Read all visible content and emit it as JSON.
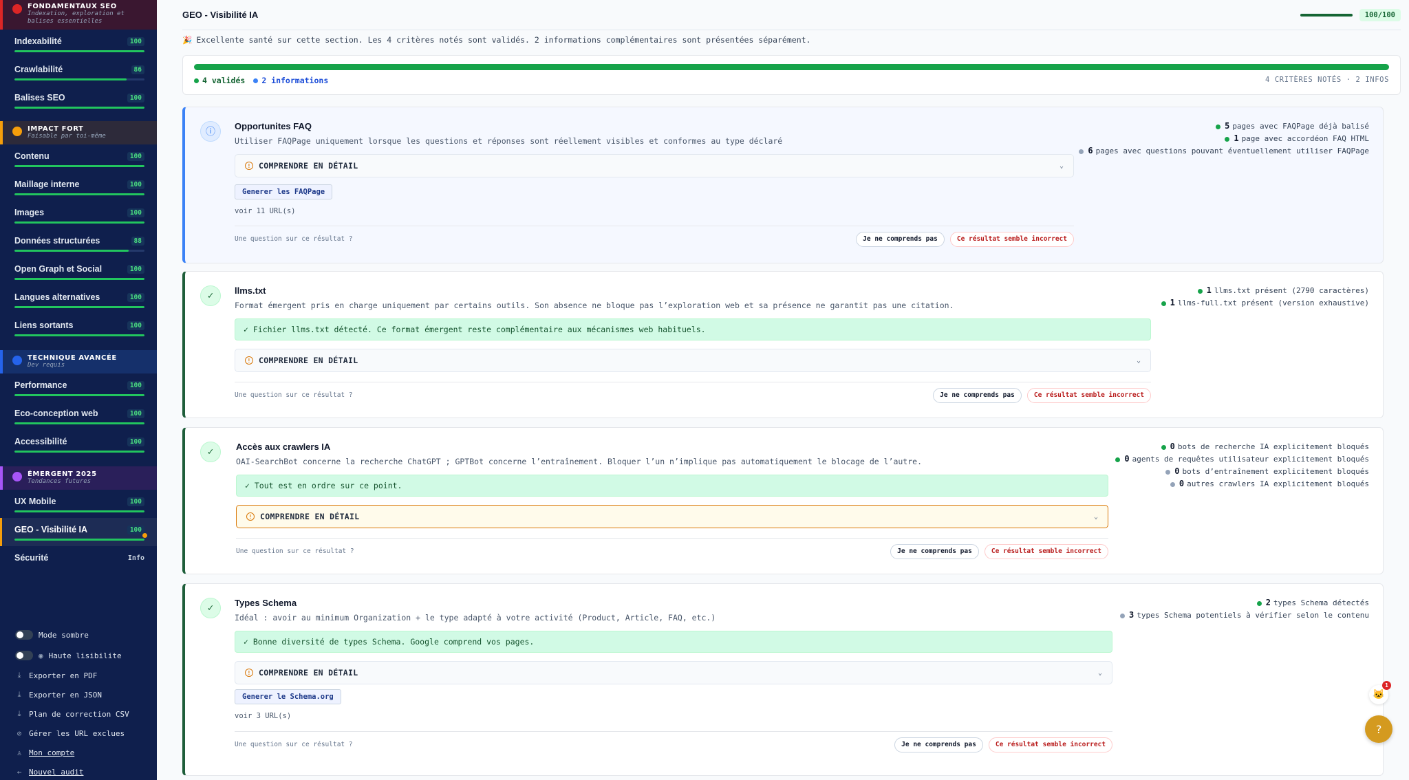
{
  "sidebar": {
    "sections": [
      {
        "title": "FONDAMENTAUX SEO",
        "subtitle": "Indexation, exploration et balises essentielles",
        "color": "#dc2626",
        "items": [
          {
            "label": "Indexabilité",
            "score": "100",
            "fill": 1.0
          },
          {
            "label": "Crawlabilité",
            "score": "86",
            "fill": 0.86
          },
          {
            "label": "Balises SEO",
            "score": "100",
            "fill": 1.0
          }
        ]
      },
      {
        "title": "IMPACT FORT",
        "subtitle": "Faisable par toi-même",
        "color": "#f59e0b",
        "items": [
          {
            "label": "Contenu",
            "score": "100",
            "fill": 1.0
          },
          {
            "label": "Maillage interne",
            "score": "100",
            "fill": 1.0
          },
          {
            "label": "Images",
            "score": "100",
            "fill": 1.0
          },
          {
            "label": "Données structurées",
            "score": "88",
            "fill": 0.88
          },
          {
            "label": "Open Graph et Social",
            "score": "100",
            "fill": 1.0
          },
          {
            "label": "Langues alternatives",
            "score": "100",
            "fill": 1.0
          },
          {
            "label": "Liens sortants",
            "score": "100",
            "fill": 1.0
          }
        ]
      },
      {
        "title": "TECHNIQUE AVANCÉE",
        "subtitle": "Dev requis",
        "color": "#2563eb",
        "items": [
          {
            "label": "Performance",
            "score": "100",
            "fill": 1.0
          },
          {
            "label": "Eco-conception web",
            "score": "100",
            "fill": 1.0
          },
          {
            "label": "Accessibilité",
            "score": "100",
            "fill": 1.0
          }
        ]
      },
      {
        "title": "ÉMERGENT 2025",
        "subtitle": "Tendances futures",
        "color": "#a855f7",
        "items": [
          {
            "label": "UX Mobile",
            "score": "100",
            "fill": 1.0
          },
          {
            "label": "GEO - Visibilité IA",
            "score": "100",
            "fill": 1.0,
            "active": true
          },
          {
            "label": "Sécurité",
            "score": "Info",
            "fill": null
          }
        ]
      }
    ],
    "toggles": [
      {
        "label": "Mode sombre",
        "icon": ""
      },
      {
        "label": "Haute lisibilite",
        "icon": "eye-icon"
      }
    ],
    "links": [
      {
        "label": "Exporter en PDF",
        "icon": "download-icon",
        "underline": false
      },
      {
        "label": "Exporter en JSON",
        "icon": "download-icon",
        "underline": false
      },
      {
        "label": "Plan de correction CSV",
        "icon": "download-icon",
        "underline": false
      },
      {
        "label": "Gérer les URL exclues",
        "icon": "exclude-icon",
        "underline": false
      },
      {
        "label": "Mon compte",
        "icon": "user-icon",
        "underline": true
      },
      {
        "label": "Nouvel audit",
        "icon": "back-arrow-icon",
        "underline": true
      }
    ]
  },
  "header": {
    "title": "GEO - Visibilité IA",
    "score": "100/100",
    "score_fraction": 1.0
  },
  "summary": {
    "emoji": "🎉",
    "text": "Excellente santé sur cette section. Les 4 critères notés sont validés. 2 informations complémentaires sont présentées séparément."
  },
  "overview": {
    "valid": "4 validés",
    "info": "2 informations",
    "right": "4 CRITÈRES NOTÉS · 2 INFOS",
    "fill": 1.0
  },
  "cards": [
    {
      "kind": "info",
      "title": "Opportunites FAQ",
      "desc": "Utiliser FAQPage uniquement lorsque les questions et réponses sont réellement visibles et conformes au type déclaré",
      "okbox": "",
      "detail": "COMPRENDRE EN DÉTAIL",
      "gen": "Generer les FAQPage",
      "voir": "voir 11 URL(s)",
      "question": "Une question sur ce résultat ?",
      "btn_a": "Je ne comprends pas",
      "btn_b": "Ce résultat semble incorrect",
      "stats": [
        {
          "n": "5",
          "t": "pages avec FAQPage déjà balisé",
          "c": "#16a34a"
        },
        {
          "n": "1",
          "t": "page avec accordéon FAQ HTML",
          "c": "#16a34a"
        },
        {
          "n": "6",
          "t": "pages avec questions pouvant éventuellement utiliser FAQPage",
          "c": "#94a3b8"
        }
      ]
    },
    {
      "kind": "ok",
      "title": "llms.txt",
      "desc": "Format émergent pris en charge uniquement par certains outils. Son absence ne bloque pas l’exploration web et sa présence ne garantit pas une citation.",
      "okbox": "✓ Fichier llms.txt détecté. Ce format émergent reste complémentaire aux mécanismes web habituels.",
      "detail": "COMPRENDRE EN DÉTAIL",
      "gen": "",
      "voir": "",
      "question": "Une question sur ce résultat ?",
      "btn_a": "Je ne comprends pas",
      "btn_b": "Ce résultat semble incorrect",
      "stats": [
        {
          "n": "1",
          "t": "llms.txt présent (2790 caractères)",
          "c": "#16a34a"
        },
        {
          "n": "1",
          "t": "llms-full.txt présent (version exhaustive)",
          "c": "#16a34a"
        }
      ]
    },
    {
      "kind": "ok",
      "title": "Accès aux crawlers IA",
      "desc": "OAI-SearchBot concerne la recherche ChatGPT ; GPTBot concerne l’entraînement. Bloquer l’un n’implique pas automatiquement le blocage de l’autre.",
      "okbox": "✓ Tout est en ordre sur ce point.",
      "detail": "COMPRENDRE EN DÉTAIL",
      "gen": "",
      "voir": "",
      "question": "Une question sur ce résultat ?",
      "btn_a": "Je ne comprends pas",
      "btn_b": "Ce résultat semble incorrect",
      "stats": [
        {
          "n": "0",
          "t": "bots de recherche IA explicitement bloqués",
          "c": "#16a34a"
        },
        {
          "n": "0",
          "t": "agents de requêtes utilisateur explicitement bloqués",
          "c": "#16a34a"
        },
        {
          "n": "0",
          "t": "bots d’entraînement explicitement bloqués",
          "c": "#94a3b8"
        },
        {
          "n": "0",
          "t": "autres crawlers IA explicitement bloqués",
          "c": "#94a3b8"
        }
      ]
    },
    {
      "kind": "ok",
      "title": "Types Schema",
      "desc": "Idéal : avoir au minimum Organization + le type adapté à votre activité (Product, Article, FAQ, etc.)",
      "okbox": "✓ Bonne diversité de types Schema. Google comprend vos pages.",
      "detail": "COMPRENDRE EN DÉTAIL",
      "gen": "Generer le Schema.org",
      "voir": "voir 3 URL(s)",
      "question": "Une question sur ce résultat ?",
      "btn_a": "Je ne comprends pas",
      "btn_b": "Ce résultat semble incorrect",
      "stats": [
        {
          "n": "2",
          "t": "types Schema détectés",
          "c": "#16a34a"
        },
        {
          "n": "3",
          "t": "types Schema potentiels à vérifier selon le contenu",
          "c": "#94a3b8"
        }
      ]
    }
  ],
  "float": {
    "badge": "1"
  }
}
